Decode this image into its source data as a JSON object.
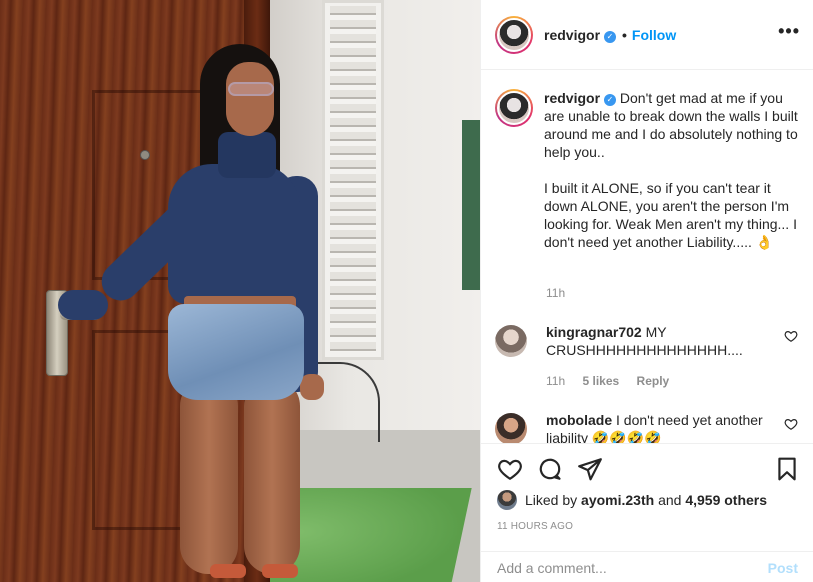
{
  "header": {
    "username": "redvigor",
    "separator": "•",
    "follow_label": "Follow",
    "more_label": "•••"
  },
  "caption": {
    "username": "redvigor",
    "text": "Don't get mad at me if you are unable to break down the walls I built around me and I do absolutely nothing to help you..\n\nI built it ALONE, so if you can't tear it down ALONE, you aren't the person I'm looking for. Weak Men aren't my thing... I don't need yet another Liability..... 👌",
    "time": "11h"
  },
  "comments": [
    {
      "username": "kingragnar702",
      "text": "MY CRUSHHHHHHHHHHHHHH....",
      "time": "11h",
      "likes": "5 likes",
      "reply_label": "Reply",
      "avatar_color": "#b9a89f"
    },
    {
      "username": "mobolade",
      "text": "I don't need yet another liability 🤣🤣🤣🤣",
      "avatar_color": "#c98f6f"
    }
  ],
  "actions": {
    "liked_by_prefix": "Liked by ",
    "liked_by_user": "ayomi.23th",
    "liked_by_and": " and ",
    "others": "4,959 others",
    "post_age": "11 HOURS AGO"
  },
  "add_comment": {
    "placeholder": "Add a comment...",
    "post_label": "Post"
  },
  "colors": {
    "link_blue": "#0095f6",
    "verified_blue": "#3897f0",
    "muted_text": "#8e8e8e",
    "post_disabled": "#b2dffc"
  },
  "icons": [
    "verified-badge-icon",
    "more-options-icon",
    "heart-icon",
    "comment-icon",
    "share-icon",
    "bookmark-icon"
  ]
}
